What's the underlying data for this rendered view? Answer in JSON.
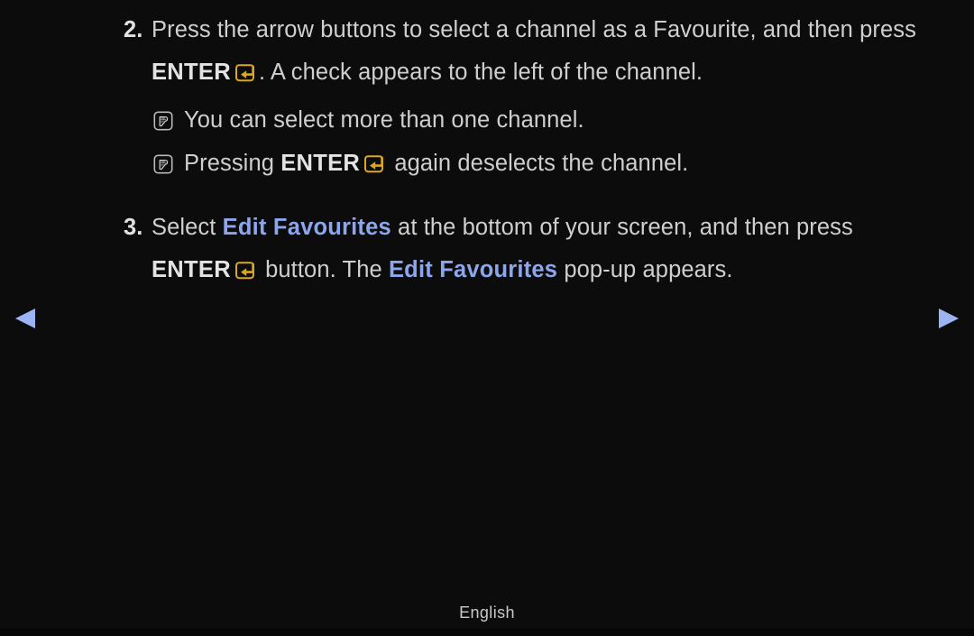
{
  "page": {
    "background_color": "#0c0c0c",
    "text_color": "#cfcfcf",
    "accent_blue": "#8ba6ed",
    "accent_gold": "#d9a625"
  },
  "steps": [
    {
      "number": "2.",
      "line1_a": "Press the arrow buttons to select a channel as a Favourite, and then press",
      "line2_key": "ENTER",
      "line2_after": ". A check appears to the left of the channel."
    },
    {
      "number": "3.",
      "line1_a": "Select ",
      "line1_hl": "Edit Favourites",
      "line1_b": " at the bottom of your screen, and then press",
      "line2_key": "ENTER",
      "line2_mid": " button. The ",
      "line2_hl": "Edit Favourites",
      "line2_after": " pop-up appears."
    }
  ],
  "notes": [
    {
      "icon": "note-icon",
      "text": "You can select more than one channel."
    },
    {
      "icon": "note-icon",
      "prefix": "Pressing ",
      "key": "ENTER",
      "suffix": " again deselects the channel."
    }
  ],
  "navigation": {
    "prev_icon": "triangle-left-icon",
    "next_icon": "triangle-right-icon",
    "prev_label": "Previous page",
    "next_label": "Next page"
  },
  "footer": {
    "language": "English"
  },
  "icons": {
    "enter_key": "enter-key-icon",
    "note": "note-icon"
  }
}
